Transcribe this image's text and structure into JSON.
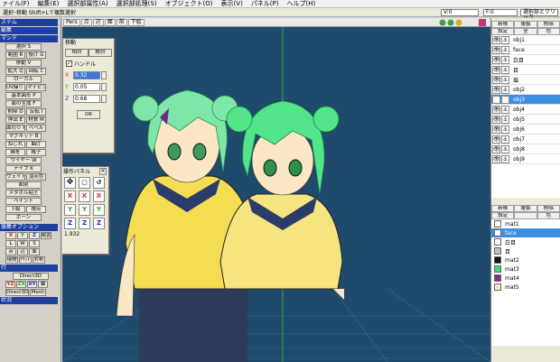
{
  "menu": [
    "ァイル(F)",
    "編集(E)",
    "選択部属性(A)",
    "選択部処理(S)",
    "オブジェクト(O)",
    "表示(V)",
    "パネル(P)",
    "ヘルプ(H)"
  ],
  "toolbar2": {
    "info": "選択･移動 Shift+Lで複数選択",
    "v_label": "V:0",
    "f_label": "F:0",
    "select_label": "選択部とクリック"
  },
  "viewport": {
    "buttons": [
      "Pers",
      "点",
      "辺",
      "面",
      "前",
      "下絵"
    ]
  },
  "left": {
    "sec1": "ステム",
    "sec2": "編集",
    "sec3": "マンド",
    "rows": [
      [
        "選択 S"
      ],
      [
        "範囲 R",
        "投げ G"
      ],
      [
        "移動 V"
      ],
      [
        "拡大 Q",
        "回転 C"
      ],
      [
        "ローカル"
      ],
      [
        "UV操り U",
        "マイピング"
      ],
      [
        "基本図形 P"
      ],
      [
        "面の生成 F"
      ],
      [
        "削除 D",
        "反転 I"
      ],
      [
        "押出 E",
        "材質 M"
      ],
      [
        "面切り H",
        "ベベル"
      ],
      [
        "マグネット B"
      ],
      [
        "ねじれ",
        "曲げ"
      ],
      [
        "縁を",
        "格子"
      ],
      [
        "ワイヤー W"
      ],
      [
        "ナイフ K"
      ],
      [
        "ウェイト",
        "頂点色"
      ],
      [
        "面別"
      ],
      [
        "メタボル粘土"
      ],
      [
        "ペイント"
      ],
      [
        "下絵",
        "視点"
      ],
      [
        "ボーン"
      ]
    ],
    "sec4": "操集オプション",
    "axes": [
      "X",
      "Y",
      "Z",
      "範囲"
    ],
    "lws": [
      "L",
      "W",
      "S"
    ],
    "opt2": [
      "点",
      "辺",
      "面"
    ],
    "opt3": [
      "現物",
      "ｸﾘｯﾄﾞ",
      "対称"
    ],
    "sec5": "行",
    "d3d": "Direct3D",
    "view_axes": [
      "YZ",
      "ZX",
      "XY",
      "軸"
    ],
    "d3d2": "Direct3D",
    "mesh": "Mesh",
    "sec6": "状況"
  },
  "move_panel": {
    "title": "移動",
    "tabs": [
      "相対",
      "絶対"
    ],
    "handle": "ハンドル",
    "x_label": "X",
    "x_val": "0.32",
    "y_label": "Y",
    "y_val": "0.05",
    "z_label": "Z",
    "z_val": "0.68",
    "ok": "OK"
  },
  "op_panel": {
    "title": "操作パネル",
    "close": "×",
    "value": "1.932"
  },
  "objects": {
    "tabs": [
      "新規",
      "複製",
      "削除"
    ],
    "sub": [
      "設定",
      "全",
      "色"
    ],
    "items": [
      "obj1",
      "face",
      "白目",
      "目",
      "眉",
      "obj2",
      "obj3",
      "obj4",
      "obj5",
      "obj6",
      "obj7",
      "obj8",
      "obj9"
    ],
    "selected": "obj3"
  },
  "materials": {
    "tabs": [
      "新規",
      "複製",
      "削除"
    ],
    "sub": [
      "設定",
      "",
      "色"
    ],
    "items": [
      {
        "name": "mat1",
        "color": "#ffffff"
      },
      {
        "name": "face",
        "color": "#ffffff"
      },
      {
        "name": "白目",
        "color": "#ffffff"
      },
      {
        "name": "目",
        "color": "#bfbfbf"
      },
      {
        "name": "mat2",
        "color": "#111111"
      },
      {
        "name": "mat3",
        "color": "#33e06a"
      },
      {
        "name": "mat4",
        "color": "#8a2a9a"
      },
      {
        "name": "mat5",
        "color": "#fbe7c4"
      }
    ],
    "selected": "face"
  }
}
